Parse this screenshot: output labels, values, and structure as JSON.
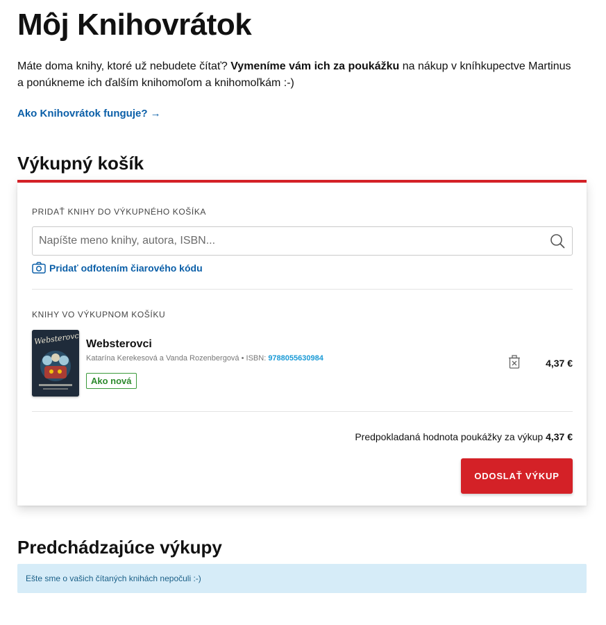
{
  "page": {
    "title": "Môj Knihovrátok",
    "intro_before": "Máte doma knihy, ktoré už nebudete čítať? ",
    "intro_bold": "Vymeníme vám ich za poukážku",
    "intro_after": " na nákup v kníhkupectve Martinus a ponúkneme ich ďalším knihomoľom a knihomoľkám :-)",
    "how_link": "Ako Knihovrátok funguje? →"
  },
  "cart": {
    "title": "Výkupný košík",
    "add_label": "PRIDAŤ KNIHY DO VÝKUPNÉHO KOŠÍKA",
    "search_placeholder": "Napíšte meno knihy, autora, ISBN...",
    "barcode_link": "Pridať odfotením čiarového kódu",
    "books_label": "KNIHY VO VÝKUPNOM KOŠÍKU",
    "items": [
      {
        "title": "Websterovci",
        "authors": "Katarína Kerekesová a Vanda Rozenbergová • ISBN: ",
        "isbn": "9788055630984",
        "condition": "Ako nová",
        "price": "4,37 €",
        "cover_text": "Websterovci"
      }
    ],
    "estimate_label": "Predpokladaná hodnota poukážky za výkup ",
    "estimate_value": "4,37 €",
    "submit_label": "ODOSLAŤ VÝKUP"
  },
  "previous": {
    "title": "Predchádzajúce výkupy",
    "empty_message": "Ešte sme o vašich čítaných knihách nepočuli :-)"
  },
  "colors": {
    "accent_red": "#d42127",
    "link_blue": "#0b5fa8",
    "isbn_blue": "#1a9ad6",
    "condition_green": "#2d8a2d",
    "info_bg": "#d6ecf8"
  },
  "icons": [
    "search-icon",
    "camera-icon",
    "trash-icon"
  ]
}
